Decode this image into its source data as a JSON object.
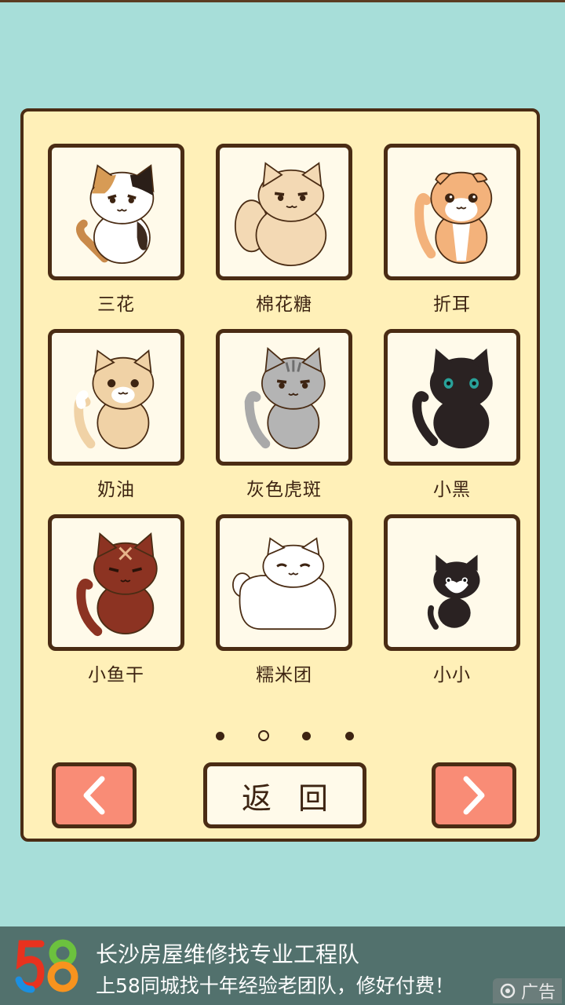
{
  "cats": [
    {
      "name": "三花",
      "icon": "calico-cat-icon"
    },
    {
      "name": "棉花糖",
      "icon": "fluffy-cream-cat-icon"
    },
    {
      "name": "折耳",
      "icon": "scottish-fold-cat-icon"
    },
    {
      "name": "奶油",
      "icon": "cream-cat-icon"
    },
    {
      "name": "灰色虎斑",
      "icon": "gray-tabby-cat-icon"
    },
    {
      "name": "小黑",
      "icon": "black-cat-icon"
    },
    {
      "name": "小鱼干",
      "icon": "brown-cat-icon"
    },
    {
      "name": "糯米团",
      "icon": "white-loaf-cat-icon"
    },
    {
      "name": "小小",
      "icon": "tuxedo-kitten-icon"
    }
  ],
  "pagination": {
    "total": 4,
    "current": 2
  },
  "nav": {
    "back_label": "返回",
    "prev_icon": "chevron-left-icon",
    "next_icon": "chevron-right-icon"
  },
  "ad": {
    "logo_text": "58",
    "title": "长沙房屋维修找专业工程队",
    "subtitle": "上58同城找十年经验老团队，修好付费！",
    "tag": "广告"
  },
  "colors": {
    "background": "#a7ded9",
    "panel": "#fff0b8",
    "button": "#f98c76",
    "outline": "#4a2c14"
  }
}
